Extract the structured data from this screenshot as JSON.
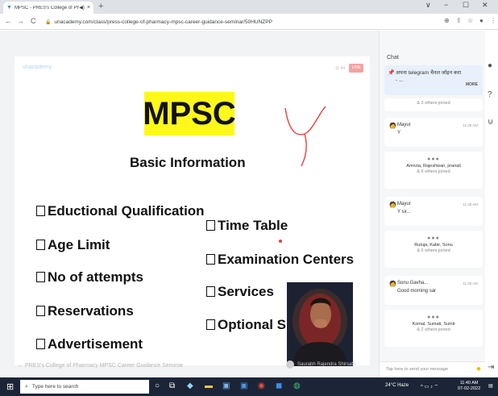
{
  "browser": {
    "tab_title": "MPSC - PRES's College of Ph",
    "tab_mute_icon": "speaker-icon",
    "tab_close": "×",
    "new_tab": "+",
    "window_controls": [
      "∨",
      "−",
      "☐",
      "✕"
    ],
    "nav": {
      "back": "←",
      "forward": "→",
      "reload": "C"
    },
    "url": "unacademy.com/class/press-college-of-pharmacy-mpsc-career-guidance-seminar/50HUNZPP"
  },
  "slide": {
    "brand": "unacademy",
    "time": "11:44",
    "live_badge": "LIVE",
    "title": "MPSC",
    "subtitle": "Basic Information",
    "left_items": [
      "Eductional Qualification",
      "Age Limit",
      "No of attempts",
      "Reservations",
      "Advertisement"
    ],
    "right_items": [
      "Time Table",
      "Examination Centers",
      "Services",
      "Optional Subje"
    ]
  },
  "bottom_bar": {
    "text": "←  PRES's College of Pharmacy MPSC Career Guidance Seminar",
    "right_text": "Saurabh Rajendra Shirsath"
  },
  "chat": {
    "title": "Chat",
    "pinned_text": "अपना telegram चैनल जॉइन करा - ...",
    "pinned_more": "MORE",
    "joined_1": "& 3 others joined",
    "msg_1": {
      "name": "Mayur",
      "time": "11:35 AM",
      "text": "Y"
    },
    "joined_2": {
      "names": "Amruta, Rajeshwari, pranali",
      "count": "& 6 others joined"
    },
    "msg_2": {
      "name": "Mayur",
      "time": "11:35 AM",
      "text": "Y sir..."
    },
    "joined_3": {
      "names": "Rutuja, Kabir, Sonu",
      "count": "& 6 others joined"
    },
    "msg_3": {
      "name": "Sonu Gavha...",
      "time": "11:36 AM",
      "text": "Good morning sar"
    },
    "joined_4": {
      "names": "Komal, Sumati, Sumit",
      "count": "& 2 others joined"
    },
    "input_placeholder": "Tap here to send your message"
  },
  "taskbar": {
    "search_placeholder": "Type here to search",
    "weather": "24°C  Haze",
    "time": "11:40 AM",
    "date": "07-02-2022"
  },
  "colors": {
    "mpsc_highlight": "#fff81a",
    "live_badge": "#f3a3a3",
    "taskbar": "#1c2537"
  }
}
